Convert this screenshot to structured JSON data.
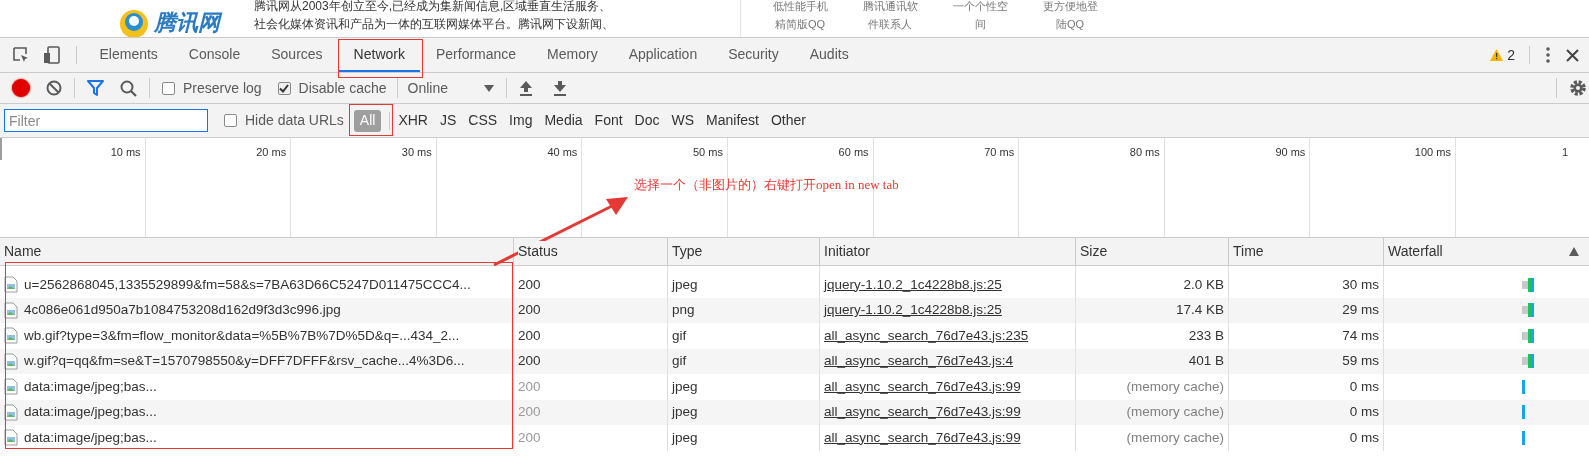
{
  "page_header": {
    "logo": "腾讯网",
    "intro_lines": [
      "腾讯网从2003年创立至今,已经成为集新闻信息,区域垂直生活服务、",
      "社会化媒体资讯和产品为一体的互联网媒体平台。腾讯网下设新闻、"
    ],
    "links": [
      {
        "lines": [
          "低性能手机",
          "精简版QQ"
        ]
      },
      {
        "lines": [
          "腾讯通讯软",
          "件联系人"
        ]
      },
      {
        "lines": [
          "一个个性空",
          "间"
        ]
      },
      {
        "lines": [
          "更方便地登",
          "陆QQ"
        ]
      }
    ]
  },
  "devtools": {
    "tabs": [
      {
        "label": "Elements",
        "selected": false
      },
      {
        "label": "Console",
        "selected": false
      },
      {
        "label": "Sources",
        "selected": false
      },
      {
        "label": "Network",
        "selected": true
      },
      {
        "label": "Performance",
        "selected": false
      },
      {
        "label": "Memory",
        "selected": false
      },
      {
        "label": "Application",
        "selected": false
      },
      {
        "label": "Security",
        "selected": false
      },
      {
        "label": "Audits",
        "selected": false
      }
    ],
    "warnings": "2"
  },
  "toolbar": {
    "recording": true,
    "preserve_log": {
      "label": "Preserve log",
      "checked": false
    },
    "disable_cache": {
      "label": "Disable cache",
      "checked": true
    },
    "throttling": "Online"
  },
  "filter_bar": {
    "placeholder": "Filter",
    "hide_data_urls": {
      "label": "Hide data URLs",
      "checked": false
    },
    "types": [
      {
        "label": "All",
        "selected": true
      },
      {
        "label": "XHR",
        "selected": false
      },
      {
        "label": "JS",
        "selected": false
      },
      {
        "label": "CSS",
        "selected": false
      },
      {
        "label": "Img",
        "selected": false
      },
      {
        "label": "Media",
        "selected": false
      },
      {
        "label": "Font",
        "selected": false
      },
      {
        "label": "Doc",
        "selected": false
      },
      {
        "label": "WS",
        "selected": false
      },
      {
        "label": "Manifest",
        "selected": false
      },
      {
        "label": "Other",
        "selected": false
      }
    ]
  },
  "timeline": {
    "ticks": [
      "10 ms",
      "20 ms",
      "30 ms",
      "40 ms",
      "50 ms",
      "60 ms",
      "70 ms",
      "80 ms",
      "90 ms",
      "100 ms",
      "1"
    ]
  },
  "table": {
    "columns": [
      {
        "label": "Name",
        "sorted": false
      },
      {
        "label": "Status",
        "sorted": false
      },
      {
        "label": "Type",
        "sorted": false
      },
      {
        "label": "Initiator",
        "sorted": false
      },
      {
        "label": "Size",
        "sorted": false
      },
      {
        "label": "Time",
        "sorted": false
      },
      {
        "label": "Waterfall",
        "sorted": true
      }
    ],
    "rows": [
      {
        "name": "u=2562868045,1335529899&fm=58&s=7BA63D66C5247D011475CCC4...",
        "status": "200",
        "type": "jpeg",
        "initiator": "jquery-1.10.2_1c4228b8.js:25",
        "size": "2.0 KB",
        "time": "30 ms",
        "cached": false
      },
      {
        "name": "4c086e061d950a7b1084753208d162d9f3d3c996.jpg",
        "status": "200",
        "type": "png",
        "initiator": "jquery-1.10.2_1c4228b8.js:25",
        "size": "17.4 KB",
        "time": "29 ms",
        "cached": false
      },
      {
        "name": "wb.gif?type=3&fm=flow_monitor&data=%5B%7B%7D%5D&q=...434_2...",
        "status": "200",
        "type": "gif",
        "initiator": "all_async_search_76d7e43.js:235",
        "size": "233 B",
        "time": "74 ms",
        "cached": false
      },
      {
        "name": "w.gif?q=qq&fm=se&T=1570798550&y=DFF7DFFF&rsv_cache...4%3D6...",
        "status": "200",
        "type": "gif",
        "initiator": "all_async_search_76d7e43.js:4",
        "size": "401 B",
        "time": "59 ms",
        "cached": false
      },
      {
        "name": "data:image/jpeg;bas...",
        "status": "200",
        "type": "jpeg",
        "initiator": "all_async_search_76d7e43.js:99",
        "size": "(memory cache)",
        "time": "0 ms",
        "cached": true
      },
      {
        "name": "data:image/jpeg;bas...",
        "status": "200",
        "type": "jpeg",
        "initiator": "all_async_search_76d7e43.js:99",
        "size": "(memory cache)",
        "time": "0 ms",
        "cached": true
      },
      {
        "name": "data:image/jpeg;bas...",
        "status": "200",
        "type": "jpeg",
        "initiator": "all_async_search_76d7e43.js:99",
        "size": "(memory cache)",
        "time": "0 ms",
        "cached": true
      }
    ]
  },
  "annotation": {
    "text": "选择一个（非图片的）右键打开open in new tab"
  }
}
